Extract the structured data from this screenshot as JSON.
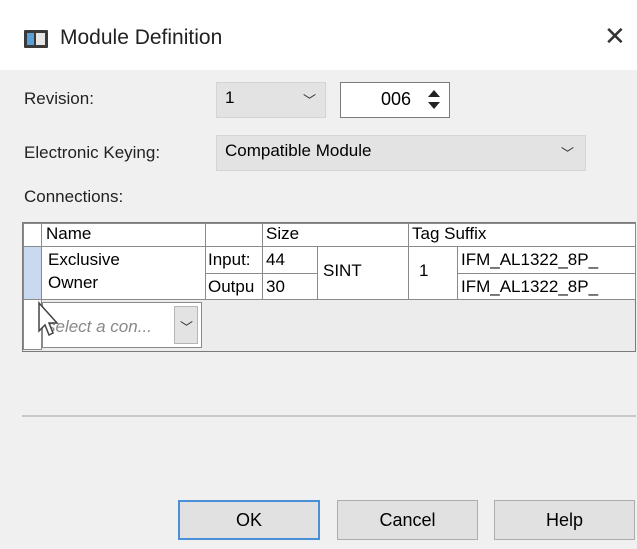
{
  "window": {
    "title": "Module Definition",
    "close_glyph": "✕"
  },
  "revision": {
    "label": "Revision:",
    "major": "1",
    "minor": "006"
  },
  "keying": {
    "label": "Electronic Keying:",
    "value": "Compatible Module"
  },
  "connections": {
    "label": "Connections:",
    "headers": {
      "name": "Name",
      "size": "Size",
      "tag_suffix": "Tag Suffix"
    },
    "row": {
      "name_line1": "Exclusive",
      "name_line2": "Owner",
      "input_label": "Input:",
      "input_size": "44",
      "output_label": "Outpu",
      "output_size": "30",
      "type": "SINT",
      "rpi": "1",
      "input_tag": "IFM_AL1322_8P_",
      "output_tag": "IFM_AL1322_8P_"
    },
    "new_row_placeholder": "select a con..."
  },
  "buttons": {
    "ok": "OK",
    "cancel": "Cancel",
    "help": "Help"
  },
  "icons": {
    "app": "module-definition-icon",
    "close": "close-icon",
    "chevron": "chevron-down-icon",
    "spin": "spin-updown-icon",
    "cursor": "mouse-pointer-icon"
  },
  "colors": {
    "accent": "#4a90d8",
    "selected_row": "#c9daf0"
  }
}
